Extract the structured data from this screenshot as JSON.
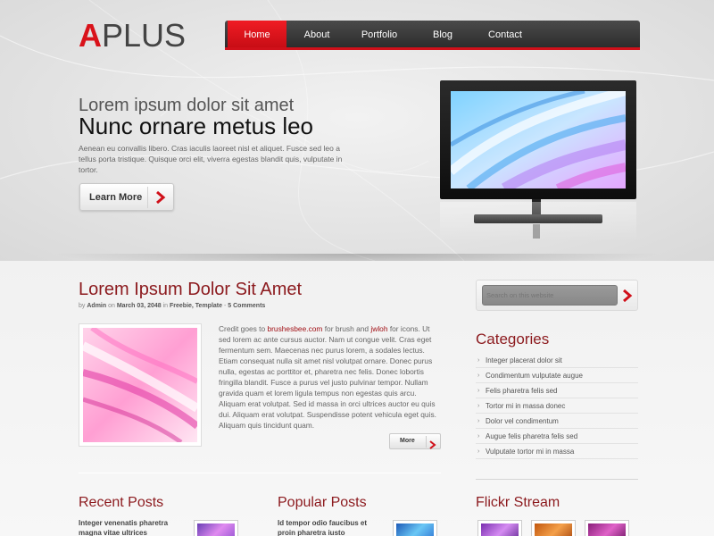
{
  "logo": {
    "first_letter": "A",
    "rest": "PLUS"
  },
  "nav": {
    "items": [
      {
        "label": "Home",
        "active": true
      },
      {
        "label": "About",
        "active": false
      },
      {
        "label": "Portfolio",
        "active": false
      },
      {
        "label": "Blog",
        "active": false
      },
      {
        "label": "Contact",
        "active": false
      }
    ]
  },
  "hero": {
    "subtitle": "Lorem ipsum dolor sit amet",
    "title": "Nunc ornare metus leo",
    "description": "Aenean eu convallis libero. Cras iaculis laoreet nisl et aliquet. Fusce sed leo a tellus porta tristique. Quisque orci elit, viverra egestas blandit quis, vulputate in tortor.",
    "button_label": "Learn More",
    "button_icon": "chevron-right-icon"
  },
  "post": {
    "title": "Lorem Ipsum Dolor Sit Amet",
    "meta": {
      "by": "by",
      "author": "Admin",
      "on": "on",
      "date": "March 03, 2048",
      "in": "in",
      "categories": "Freebie, Template",
      "dash": "-",
      "comments": "5 Comments"
    },
    "body_prefix": "Credit goes to ",
    "link1": "brushesbee.com",
    "body_mid": " for brush and ",
    "link2": "jwloh",
    "body_suffix": " for icons. Ut sed lorem ac ante cursus auctor. Nam ut congue velit. Cras eget fermentum sem. Maecenas nec purus lorem, a sodales lectus. Etiam consequat nulla sit amet nisl volutpat ornare. Donec purus nulla, egestas ac porttitor et, pharetra nec felis. Donec lobortis fringilla blandit. Fusce a purus vel justo pulvinar tempor. Nullam gravida quam et lorem ligula tempus non egestas quis arcu. Aliquam erat volutpat. Sed id massa in orci ultrices auctor eu quis dui. Aliquam erat volutpat. Suspendisse potent vehicula eget quis. Aliquam quis tincidunt quam.",
    "more_label": "More"
  },
  "sidebar": {
    "search_placeholder": "Search on this website",
    "categories_title": "Categories",
    "categories": [
      "Integer placerat dolor sit",
      "Condimentum vulputate augue",
      "Felis pharetra felis sed",
      "Tortor mi in massa donec",
      "Dolor vel condimentum",
      "Augue felis pharetra felis sed",
      "Vulputate tortor mi in massa"
    ]
  },
  "bottom": {
    "recent_title": "Recent Posts",
    "recent_text": "Integer venenatis pharetra magna vitae ultrices",
    "popular_title": "Popular Posts",
    "popular_text": "Id tempor odio faucibus et proin pharetra iusto",
    "flickr_title": "Flickr Stream"
  },
  "colors": {
    "accent": "#d9121a",
    "heading": "#8c1a1e",
    "nav_bg": "#333333"
  }
}
